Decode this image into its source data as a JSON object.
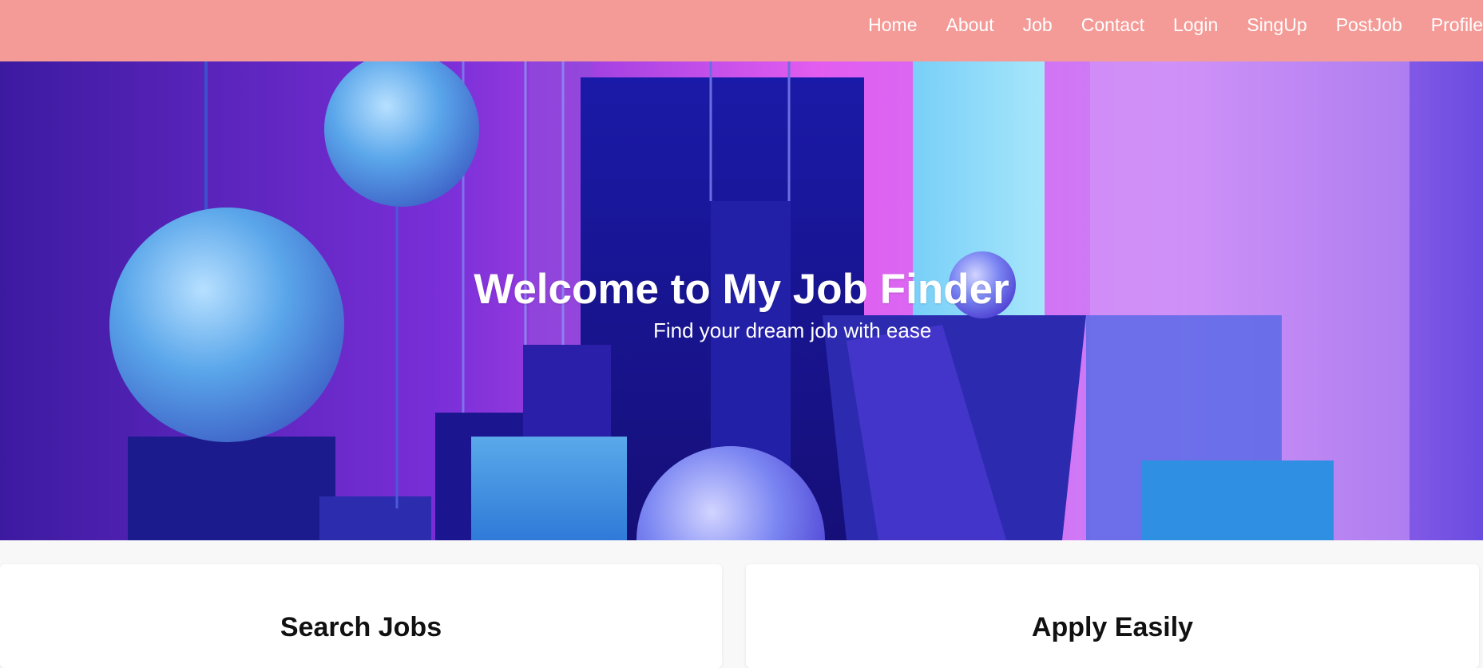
{
  "nav": {
    "items": [
      {
        "label": "Home"
      },
      {
        "label": "About"
      },
      {
        "label": "Job"
      },
      {
        "label": "Contact"
      },
      {
        "label": "Login"
      },
      {
        "label": "SingUp"
      },
      {
        "label": "PostJob"
      },
      {
        "label": "Profile"
      }
    ]
  },
  "hero": {
    "title": "Welcome to My Job Finder",
    "subtitle": "Find your dream job with ease"
  },
  "cards": [
    {
      "title": "Search Jobs"
    },
    {
      "title": "Apply Easily"
    }
  ],
  "colors": {
    "navbar": "#f49b98",
    "page_background": "#f8f8f9",
    "card_background": "#ffffff"
  }
}
